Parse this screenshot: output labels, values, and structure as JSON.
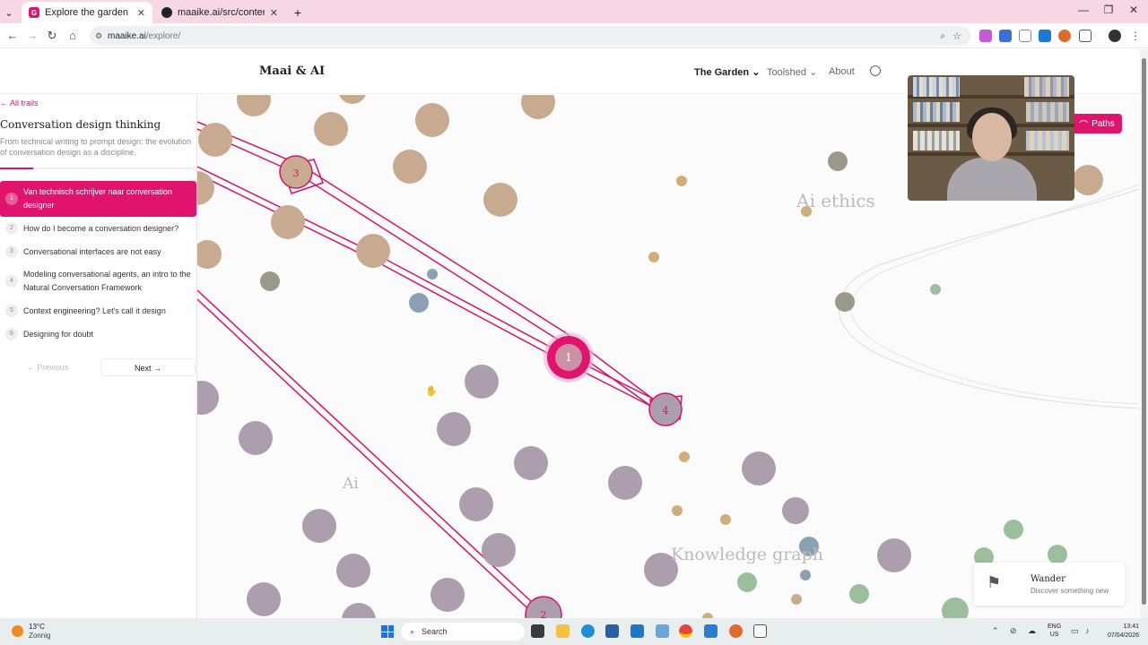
{
  "browser": {
    "tabs": [
      {
        "title": "Explore the garden",
        "active": true
      },
      {
        "title": "maaike.ai/src/content/articles/i",
        "active": false
      }
    ],
    "address": {
      "host": "maaike.ai",
      "path": "/explore/"
    }
  },
  "site": {
    "logo": "Maai & AI",
    "nav": [
      {
        "label": "The Garden",
        "active": true
      },
      {
        "label": "Toolshed",
        "active": false
      },
      {
        "label": "About",
        "active": false
      }
    ]
  },
  "trail": {
    "back_label": "← All trails",
    "title": "Conversation design thinking",
    "description": "From technical writing to prompt design: the evolution of conversation design as a discipline.",
    "progress": 0.17,
    "items": [
      {
        "num": "1",
        "label": "Van technisch schrijver naar conversation designer",
        "active": true
      },
      {
        "num": "2",
        "label": "How do I become a conversation designer?",
        "active": false
      },
      {
        "num": "3",
        "label": "Conversational interfaces are not easy",
        "active": false
      },
      {
        "num": "4",
        "label": "Modeling conversational agents, an intro to the Natural Conversation Framework",
        "active": false
      },
      {
        "num": "5",
        "label": "Context engineering? Let's call it design",
        "active": false
      },
      {
        "num": "6",
        "label": "Designing for doubt",
        "active": false
      }
    ],
    "prev_label": "← Previous",
    "next_label": "Next →"
  },
  "garden": {
    "clusters": [
      "Ai ethics",
      "Ai",
      "Knowledge graph"
    ],
    "highlighted_node": "1",
    "node_labels": [
      "3",
      "4",
      "2"
    ],
    "paths_label": "Paths",
    "accent": "#e0136d"
  },
  "wander": {
    "title": "Wander",
    "subtitle": "Discover something new"
  },
  "taskbar": {
    "temp": "13°C",
    "weather": "Zonnig",
    "search": "Search",
    "lang_top": "ENG",
    "lang_bottom": "US",
    "time": "13:41",
    "date": "07/04/2026"
  }
}
